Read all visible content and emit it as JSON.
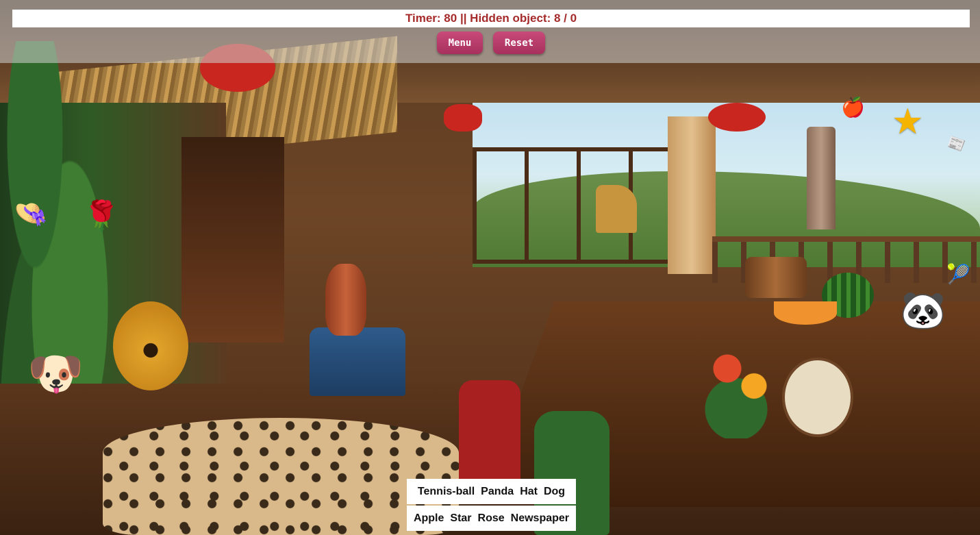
{
  "status": {
    "text": "Timer: 80 || Hidden object: 8 / 0",
    "timer": 80,
    "hidden_found": 8,
    "hidden_total_display": 0
  },
  "buttons": {
    "menu_label": "Menu",
    "reset_label": "Reset",
    "color": "#b23a68"
  },
  "hidden_objects": [
    {
      "name": "Hat",
      "icon": "hat-icon",
      "glyph": "👒"
    },
    {
      "name": "Rose",
      "icon": "rose-icon",
      "glyph": "🌹"
    },
    {
      "name": "Dog",
      "icon": "dog-icon",
      "glyph": "🐶"
    },
    {
      "name": "Apple",
      "icon": "apple-icon",
      "glyph": "🍎"
    },
    {
      "name": "Star",
      "icon": "star-icon",
      "glyph": "★"
    },
    {
      "name": "Newspaper",
      "icon": "newspaper-icon",
      "glyph": "📰"
    },
    {
      "name": "Tennis-ball",
      "icon": "tennis-ball-icon",
      "glyph": "🎾"
    },
    {
      "name": "Panda",
      "icon": "panda-icon",
      "glyph": "🐼"
    }
  ],
  "word_list": {
    "row1": [
      "Tennis-ball",
      "Panda",
      "Hat",
      "Dog"
    ],
    "row2": [
      "Apple",
      "Star",
      "Rose",
      "Newspaper"
    ]
  },
  "colors": {
    "status_text": "#a52a2a",
    "button": "#b23a68",
    "star": "#f5b400"
  }
}
